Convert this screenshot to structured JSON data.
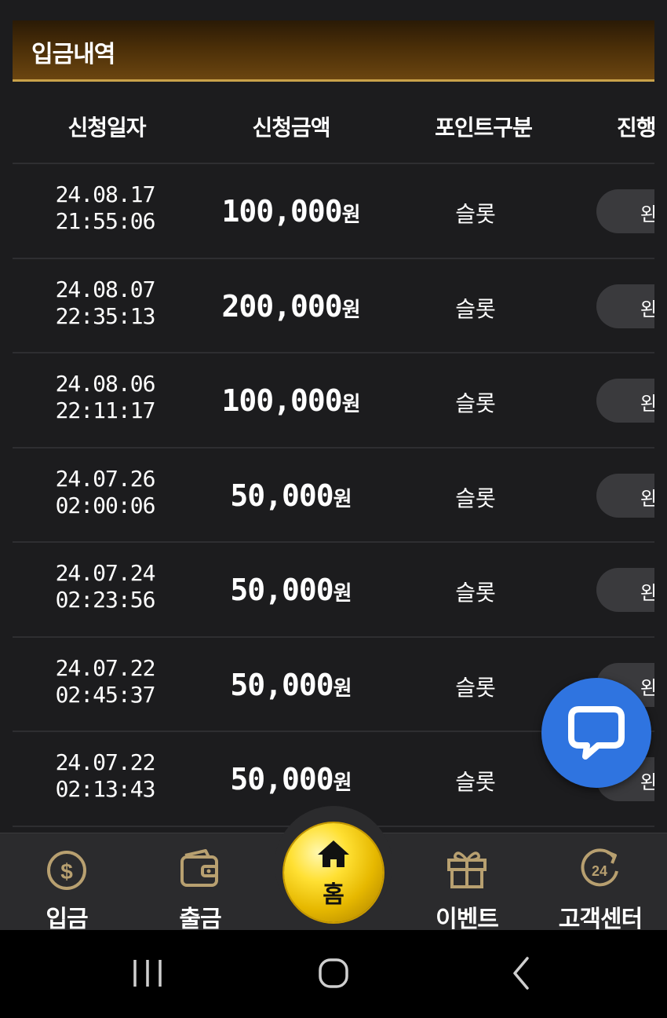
{
  "header": {
    "title": "입금내역"
  },
  "table": {
    "columns": [
      "신청일자",
      "신청금액",
      "포인트구분",
      "진행"
    ],
    "rows": [
      {
        "date": "24.08.17",
        "time": "21:55:06",
        "amount": "100,000",
        "unit": "원",
        "point_type": "슬롯",
        "status": "완"
      },
      {
        "date": "24.08.07",
        "time": "22:35:13",
        "amount": "200,000",
        "unit": "원",
        "point_type": "슬롯",
        "status": "완"
      },
      {
        "date": "24.08.06",
        "time": "22:11:17",
        "amount": "100,000",
        "unit": "원",
        "point_type": "슬롯",
        "status": "완"
      },
      {
        "date": "24.07.26",
        "time": "02:00:06",
        "amount": "50,000",
        "unit": "원",
        "point_type": "슬롯",
        "status": "완"
      },
      {
        "date": "24.07.24",
        "time": "02:23:56",
        "amount": "50,000",
        "unit": "원",
        "point_type": "슬롯",
        "status": "완"
      },
      {
        "date": "24.07.22",
        "time": "02:45:37",
        "amount": "50,000",
        "unit": "원",
        "point_type": "슬롯",
        "status": "완"
      },
      {
        "date": "24.07.22",
        "time": "02:13:43",
        "amount": "50,000",
        "unit": "원",
        "point_type": "슬롯",
        "status": "완"
      }
    ]
  },
  "bottom_nav": {
    "deposit": {
      "label": "입금",
      "icon": "dollar-coin-icon"
    },
    "withdraw": {
      "label": "출금",
      "icon": "wallet-icon"
    },
    "home": {
      "label": "홈",
      "icon": "house-icon"
    },
    "event": {
      "label": "이벤트",
      "icon": "gift-icon"
    },
    "support": {
      "label": "고객센터",
      "icon": "24h-support-icon"
    }
  },
  "chat_button": {
    "icon": "chat-bubble-icon"
  },
  "system_nav": {
    "recents": "recents-icon",
    "home": "home-circle-icon",
    "back": "back-chevron-icon"
  },
  "colors": {
    "background": "#1c1c1e",
    "header_gold": "#c9a24a",
    "chat_blue": "#2f74e0",
    "home_gold": "#ffe033"
  }
}
